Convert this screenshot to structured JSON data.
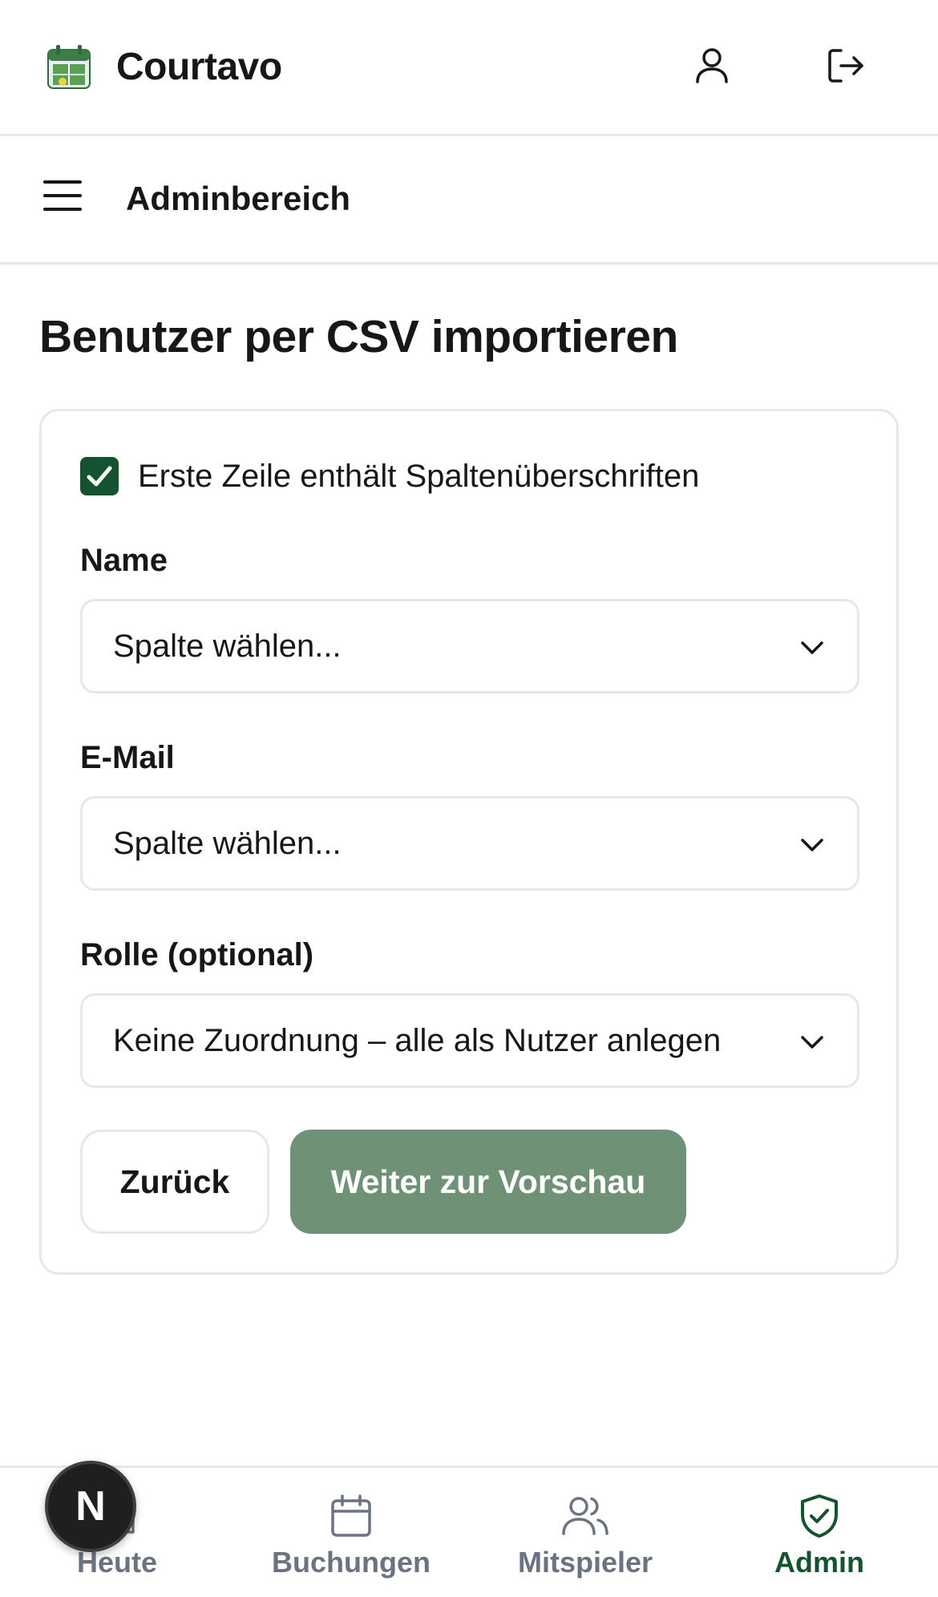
{
  "header": {
    "app_title": "Courtavo",
    "logo_icon": "calendar-court-logo",
    "profile_icon": "user-icon",
    "logout_icon": "logout-icon"
  },
  "subheader": {
    "menu_icon": "hamburger-menu-icon",
    "title": "Adminbereich"
  },
  "page": {
    "title": "Benutzer per CSV importieren"
  },
  "form": {
    "header_checkbox": {
      "label": "Erste Zeile enthält Spaltenüberschriften",
      "checked": true
    },
    "fields": [
      {
        "label": "Name",
        "value": "Spalte wählen..."
      },
      {
        "label": "E-Mail",
        "value": "Spalte wählen..."
      },
      {
        "label": "Rolle (optional)",
        "value": "Keine Zuordnung – alle als Nutzer anlegen"
      }
    ],
    "back_label": "Zurück",
    "next_label": "Weiter zur Vorschau"
  },
  "bottom_nav": {
    "items": [
      {
        "label": "Heute",
        "icon": "home-icon",
        "active": false
      },
      {
        "label": "Buchungen",
        "icon": "calendar-icon",
        "active": false
      },
      {
        "label": "Mitspieler",
        "icon": "users-icon",
        "active": false
      },
      {
        "label": "Admin",
        "icon": "shield-check-icon",
        "active": true
      }
    ]
  },
  "dev_badge": {
    "label": "N"
  },
  "colors": {
    "brand_dark_green": "#14532d",
    "button_green": "#6f9277",
    "border": "#e5e7eb",
    "muted_text": "#6b7280"
  }
}
